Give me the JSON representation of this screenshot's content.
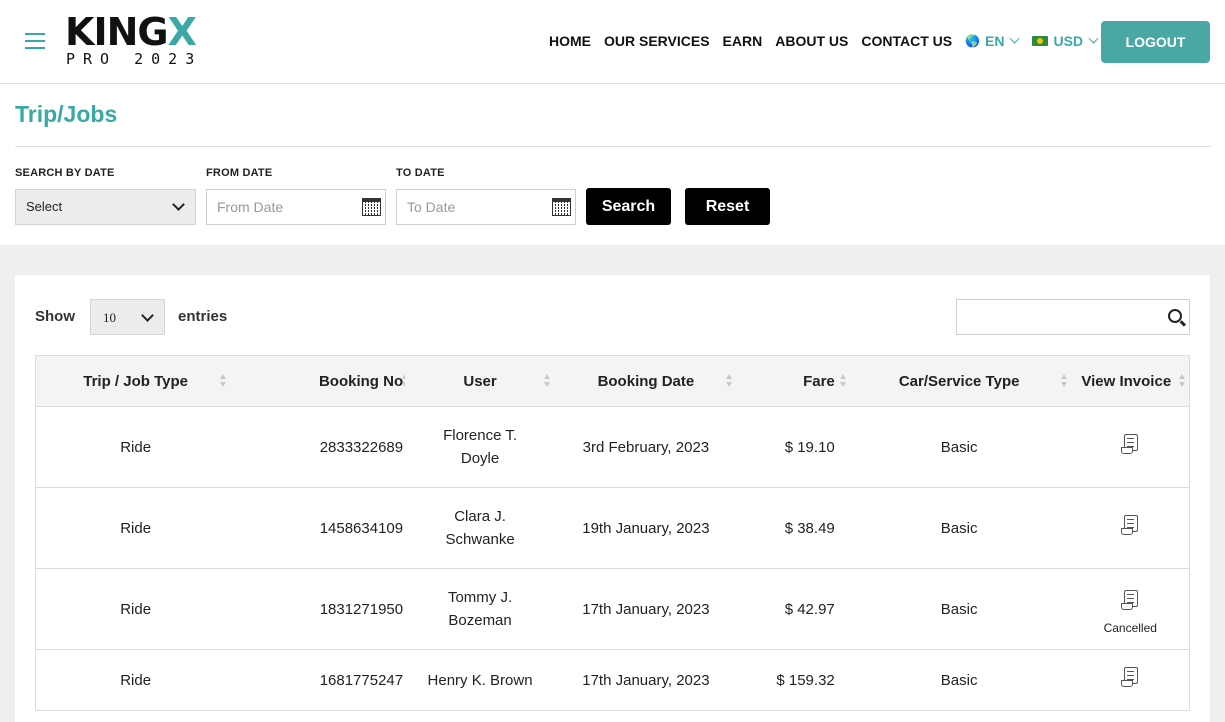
{
  "header": {
    "logo_main": "KINGX",
    "logo_sub": "PRO 2023",
    "nav": [
      "HOME",
      "OUR SERVICES",
      "EARN",
      "ABOUT US",
      "CONTACT US"
    ],
    "language": "EN",
    "currency": "USD",
    "logout_label": "LOGOUT"
  },
  "page": {
    "title": "Trip/Jobs"
  },
  "filters": {
    "search_by_date_label": "SEARCH BY DATE",
    "search_by_date_value": "Select",
    "from_date_label": "FROM DATE",
    "from_date_placeholder": "From Date",
    "to_date_label": "TO DATE",
    "to_date_placeholder": "To Date",
    "search_label": "Search",
    "reset_label": "Reset"
  },
  "table_controls": {
    "show_label": "Show",
    "entries_value": "10",
    "entries_label": "entries",
    "search_placeholder": ""
  },
  "table": {
    "columns": [
      "Trip / Job Type",
      "Booking No",
      "User",
      "Booking Date",
      "Fare",
      "Car/Service Type",
      "View Invoice"
    ],
    "rows": [
      {
        "type": "Ride",
        "booking_no": "2833322689",
        "user_line1": "Florence T.",
        "user_line2": "Doyle",
        "date": "3rd February, 2023",
        "fare": "$ 19.10",
        "service": "Basic",
        "status": ""
      },
      {
        "type": "Ride",
        "booking_no": "1458634109",
        "user_line1": "Clara J.",
        "user_line2": "Schwanke",
        "date": "19th January, 2023",
        "fare": "$ 38.49",
        "service": "Basic",
        "status": ""
      },
      {
        "type": "Ride",
        "booking_no": "1831271950",
        "user_line1": "Tommy J.",
        "user_line2": "Bozeman",
        "date": "17th January, 2023",
        "fare": "$ 42.97",
        "service": "Basic",
        "status": "Cancelled"
      },
      {
        "type": "Ride",
        "booking_no": "1681775247",
        "user_line1": "Henry K. Brown",
        "user_line2": "",
        "date": "17th January, 2023",
        "fare": "$ 159.32",
        "service": "Basic",
        "status": ""
      }
    ]
  },
  "colors": {
    "accent": "#3aa9a6",
    "button_dark": "#000000",
    "logout_bg": "#4aa8a4"
  }
}
